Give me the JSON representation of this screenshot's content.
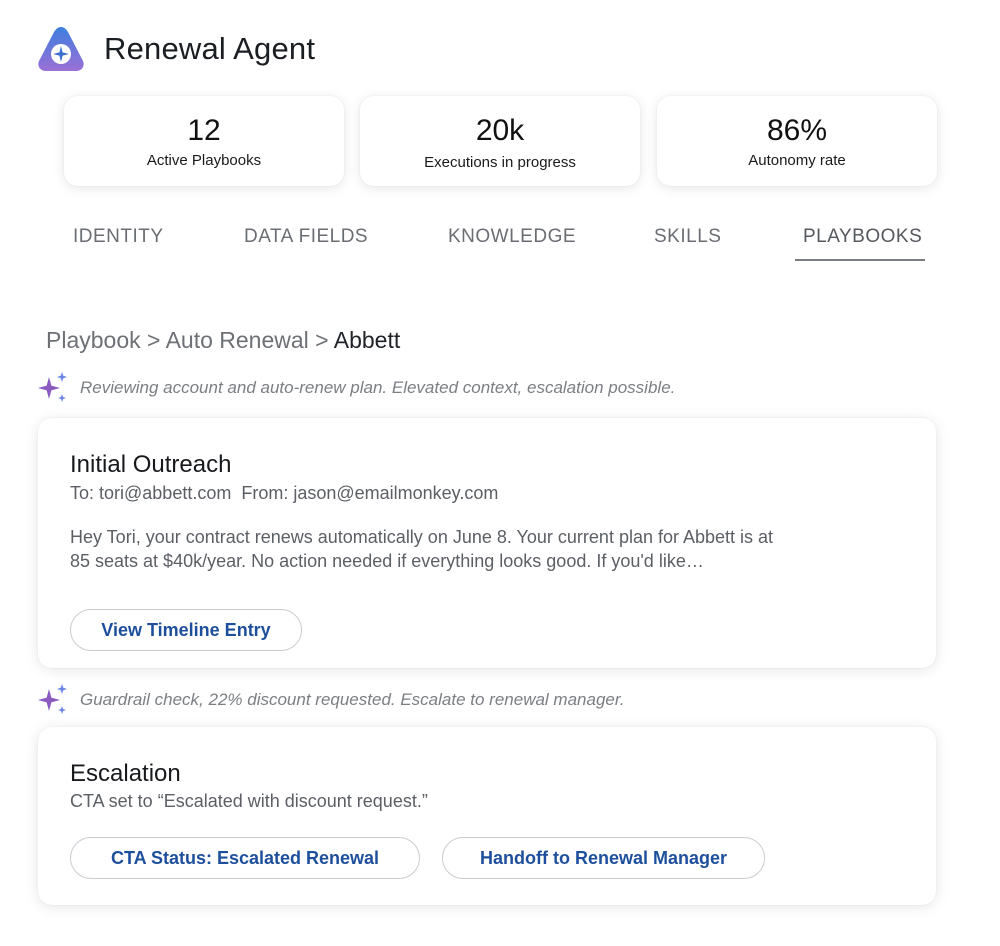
{
  "app": {
    "title": "Renewal Agent",
    "logo_icon": "triangle-sparkle-logo-icon"
  },
  "stats": [
    {
      "value": "12",
      "label": "Active Playbooks"
    },
    {
      "value": "20k",
      "label": "Executions in progress"
    },
    {
      "value": "86%",
      "label": "Autonomy rate"
    }
  ],
  "tabs": [
    {
      "label": "IDENTITY"
    },
    {
      "label": "DATA FIELDS"
    },
    {
      "label": "KNOWLEDGE"
    },
    {
      "label": "SKILLS"
    },
    {
      "label": "PLAYBOOKS",
      "active": true
    }
  ],
  "breadcrumb": {
    "part1": "Playbook",
    "sep": ">",
    "part2": "Auto Renewal",
    "current": "Abbett"
  },
  "notes": [
    {
      "icon": "sparkle-icon",
      "text": "Reviewing account and auto-renew plan. Elevated context, escalation possible."
    },
    {
      "icon": "sparkle-icon",
      "text": "Guardrail check, 22% discount requested. Escalate to renewal manager."
    }
  ],
  "outreach": {
    "title": "Initial Outreach",
    "meta": "To: tori@abbett.com  From: jason@emailmonkey.com",
    "body_line1": "Hey Tori, your contract renews automatically on June 8. Your current plan for Abbett is at",
    "body_line2": "85 seats at $40k/year. No action needed if everything looks good. If you'd like…",
    "button": "View Timeline Entry"
  },
  "escalation": {
    "title": "Escalation",
    "subtitle": "CTA set to “Escalated with discount request.”",
    "button1": "CTA Status: Escalated Renewal",
    "button2": "Handoff to Renewal Manager"
  },
  "colors": {
    "accent": "#1e4f9c",
    "sparkle": "#7b5cc4",
    "logo_top": "#3d7fe0",
    "logo_bottom": "#9b6fd6"
  }
}
